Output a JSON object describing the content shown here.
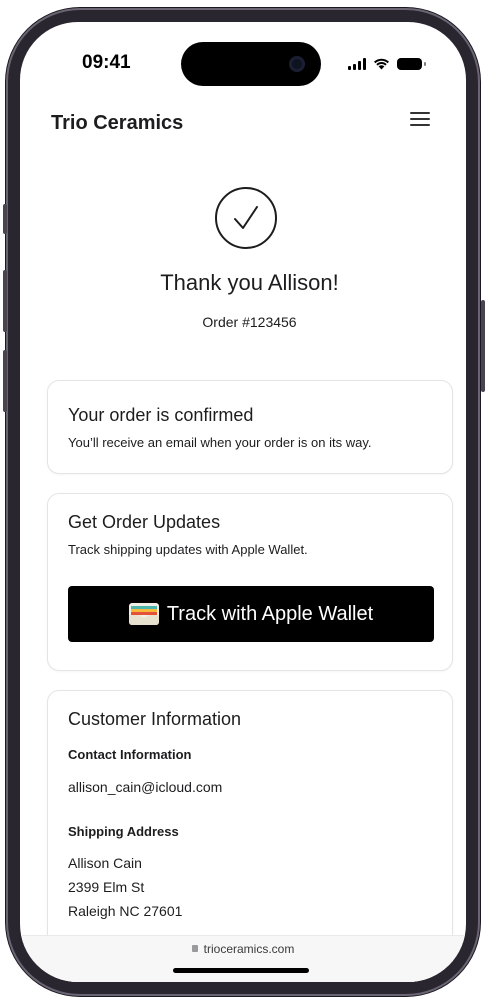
{
  "status_bar": {
    "time": "09:41"
  },
  "header": {
    "brand": "Trio Ceramics"
  },
  "hero": {
    "title": "Thank you Allison!",
    "order_number": "Order #123456"
  },
  "confirmation_card": {
    "title": "Your order is confirmed",
    "text": "You’ll receive an email when your order is on its way."
  },
  "updates_card": {
    "title": "Get Order Updates",
    "text": "Track shipping updates with Apple Wallet.",
    "button_label": "Track with Apple Wallet"
  },
  "customer_card": {
    "title": "Customer Information",
    "contact_label": "Contact Information",
    "email": "allison_cain@icloud.com",
    "shipping_label": "Shipping Address",
    "address_lines": [
      "Allison Cain",
      "2399 Elm St",
      "Raleigh NC 27601"
    ]
  },
  "url_bar": {
    "url": "trioceramics.com"
  },
  "icons": {
    "check": "check-circle-icon",
    "menu": "hamburger-menu-icon",
    "wallet": "wallet-icon",
    "lock": "lock-icon"
  },
  "colors": {
    "button_bg": "#000000",
    "button_text": "#ffffff",
    "card_border": "#e4e4e7",
    "text": "#1d1d1f"
  }
}
